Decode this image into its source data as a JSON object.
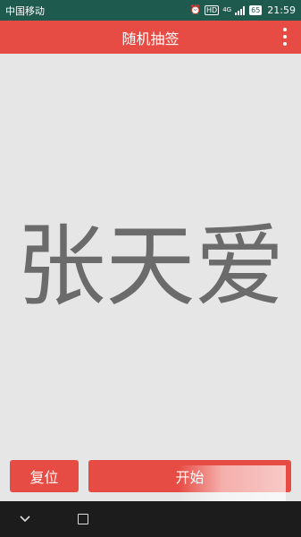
{
  "status_bar": {
    "carrier": "中国移动",
    "hd_label": "HD",
    "network": "4G",
    "battery": "65",
    "time": "21:59"
  },
  "app_bar": {
    "title": "随机抽签",
    "more_icon": "more-vert-icon"
  },
  "main": {
    "result": "张天爱"
  },
  "actions": {
    "reset_label": "复位",
    "start_label": "开始"
  },
  "nav_bar": {
    "back_icon": "chevron-down-icon",
    "home_icon": "square-icon"
  },
  "colors": {
    "accent": "#e74c44",
    "status_bar": "#1f5a4f",
    "background": "#e6e6e6",
    "result_text": "#6b6b6b",
    "nav_bar": "#1c1c1c"
  }
}
